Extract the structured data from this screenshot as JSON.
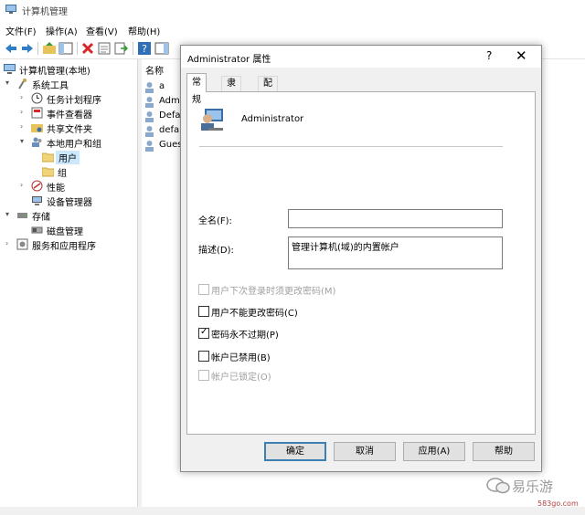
{
  "window": {
    "title": "计算机管理"
  },
  "menu": [
    "文件(F)",
    "操作(A)",
    "查看(V)",
    "帮助(H)"
  ],
  "tree": {
    "items": [
      {
        "label": "计算机管理(本地)",
        "expander": "",
        "icon": "computer-management-icon"
      },
      {
        "label": "系统工具",
        "expander": "▾",
        "icon": "system-tools-icon"
      },
      {
        "label": "任务计划程序",
        "expander": "›",
        "icon": "task-scheduler-icon"
      },
      {
        "label": "事件查看器",
        "expander": "›",
        "icon": "event-viewer-icon"
      },
      {
        "label": "共享文件夹",
        "expander": "›",
        "icon": "shared-folders-icon"
      },
      {
        "label": "本地用户和组",
        "expander": "▾",
        "icon": "local-users-groups-icon"
      },
      {
        "label": "用户",
        "expander": "",
        "icon": "folder-icon",
        "selected": true
      },
      {
        "label": "组",
        "expander": "",
        "icon": "folder-icon"
      },
      {
        "label": "性能",
        "expander": "›",
        "icon": "performance-icon"
      },
      {
        "label": "设备管理器",
        "expander": "",
        "icon": "device-manager-icon"
      },
      {
        "label": "存储",
        "expander": "▾",
        "icon": "storage-icon"
      },
      {
        "label": "磁盘管理",
        "expander": "",
        "icon": "disk-management-icon"
      },
      {
        "label": "服务和应用程序",
        "expander": "›",
        "icon": "services-apps-icon"
      }
    ]
  },
  "list": {
    "header": "名称",
    "rows": [
      "a",
      "Admi",
      "Defa",
      "defa",
      "Gues"
    ]
  },
  "dialog": {
    "title": "Administrator 属性",
    "help": "?",
    "close": "✕",
    "tabs": [
      "常规",
      "隶属于",
      "配置文件"
    ],
    "user_name": "Administrator",
    "fullname_label": "全名(F):",
    "fullname_value": "",
    "desc_label": "描述(D):",
    "desc_value": "管理计算机(域)的内置帐户",
    "checkboxes": [
      {
        "label": "用户下次登录时须更改密码(M)",
        "checked": false,
        "disabled": true
      },
      {
        "label": "用户不能更改密码(C)",
        "checked": false,
        "disabled": false
      },
      {
        "label": "密码永不过期(P)",
        "checked": true,
        "disabled": false
      },
      {
        "label": "帐户已禁用(B)",
        "checked": false,
        "disabled": false
      },
      {
        "label": "帐户已锁定(O)",
        "checked": false,
        "disabled": true
      }
    ],
    "buttons": [
      "确定",
      "取消",
      "应用(A)",
      "帮助"
    ]
  },
  "watermark": {
    "text": "易乐游",
    "url": "583go.com"
  },
  "colors": {
    "accent": "#3c7fb1",
    "highlight": "#e0504a",
    "selection": "#cce8ff"
  }
}
